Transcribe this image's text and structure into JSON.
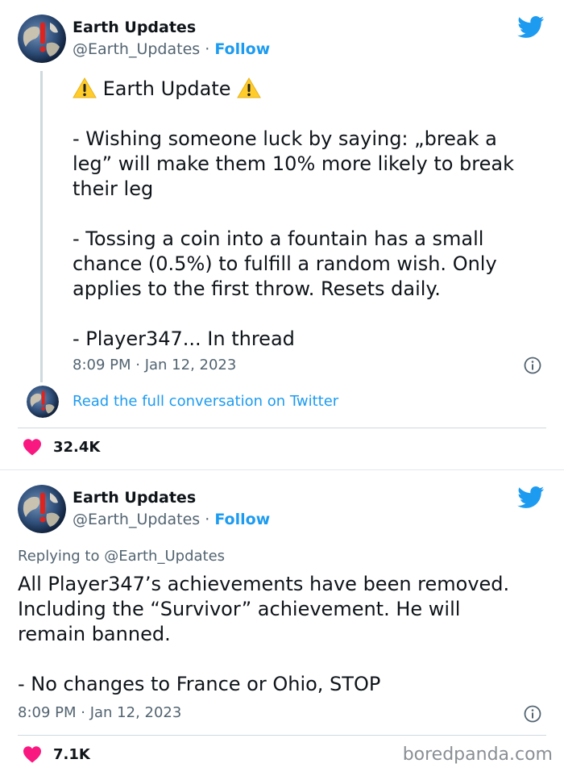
{
  "tweet1": {
    "author_name": "Earth Updates",
    "handle": "@Earth_Updates",
    "separator": "·",
    "follow_label": "Follow",
    "title_text": "Earth Update",
    "paragraphs": [
      "- Wishing someone luck by saying: „break a\nleg” will make them 10% more likely to break\ntheir leg",
      "- Tossing a coin into a fountain has a small\nchance (0.5%) to fulfill a random wish. Only\napplies to the first throw. Resets daily.",
      "- Player347... In thread"
    ],
    "timestamp": "8:09 PM · Jan 12, 2023",
    "read_full_label": "Read the full conversation on Twitter",
    "like_count": "32.4K"
  },
  "tweet2": {
    "author_name": "Earth Updates",
    "handle": "@Earth_Updates",
    "separator": "·",
    "follow_label": "Follow",
    "replying_to": "Replying to @Earth_Updates",
    "paragraphs": [
      "All Player347’s achievements have been removed.\nIncluding the “Survivor” achievement. He will\nremain banned.",
      "- No changes to France or Ohio, STOP"
    ],
    "timestamp": "8:09 PM · Jan 12, 2023",
    "like_count": "7.1K"
  },
  "watermark": "boredpanda.com",
  "colors": {
    "accent": "#1d9bf0",
    "heart": "#f91880",
    "muted": "#536471"
  },
  "icons": [
    "earth-avatar-icon",
    "twitter-bird-icon",
    "warning-icon",
    "info-icon",
    "heart-icon"
  ]
}
